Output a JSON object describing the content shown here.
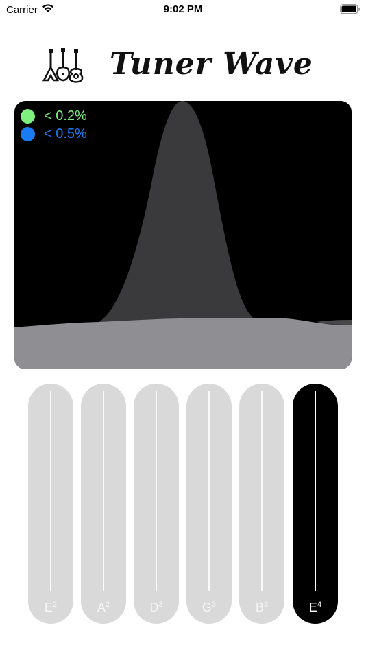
{
  "status_bar": {
    "carrier": "Carrier",
    "time": "9:02 PM",
    "wifi_icon": "wifi-icon",
    "battery_icon": "battery-icon"
  },
  "header": {
    "title": "Tuner Wave",
    "logo_icon": "guitars-icon"
  },
  "graph": {
    "background_color": "#000000",
    "legend": [
      {
        "label": "< 0.2%",
        "color": "#7ef07e"
      },
      {
        "label": "< 0.5%",
        "color": "#1a7cf5"
      }
    ],
    "peak_color": "#3a3a3c",
    "base_color": "#8e8e93"
  },
  "strings": {
    "items": [
      {
        "note": "E",
        "octave": "2",
        "active": false
      },
      {
        "note": "A",
        "octave": "2",
        "active": false
      },
      {
        "note": "D",
        "octave": "3",
        "active": false
      },
      {
        "note": "G",
        "octave": "3",
        "active": false
      },
      {
        "note": "B",
        "octave": "3",
        "active": false
      },
      {
        "note": "E",
        "octave": "4",
        "active": true
      }
    ],
    "inactive_color": "#d9d9d9",
    "active_color": "#000000"
  }
}
